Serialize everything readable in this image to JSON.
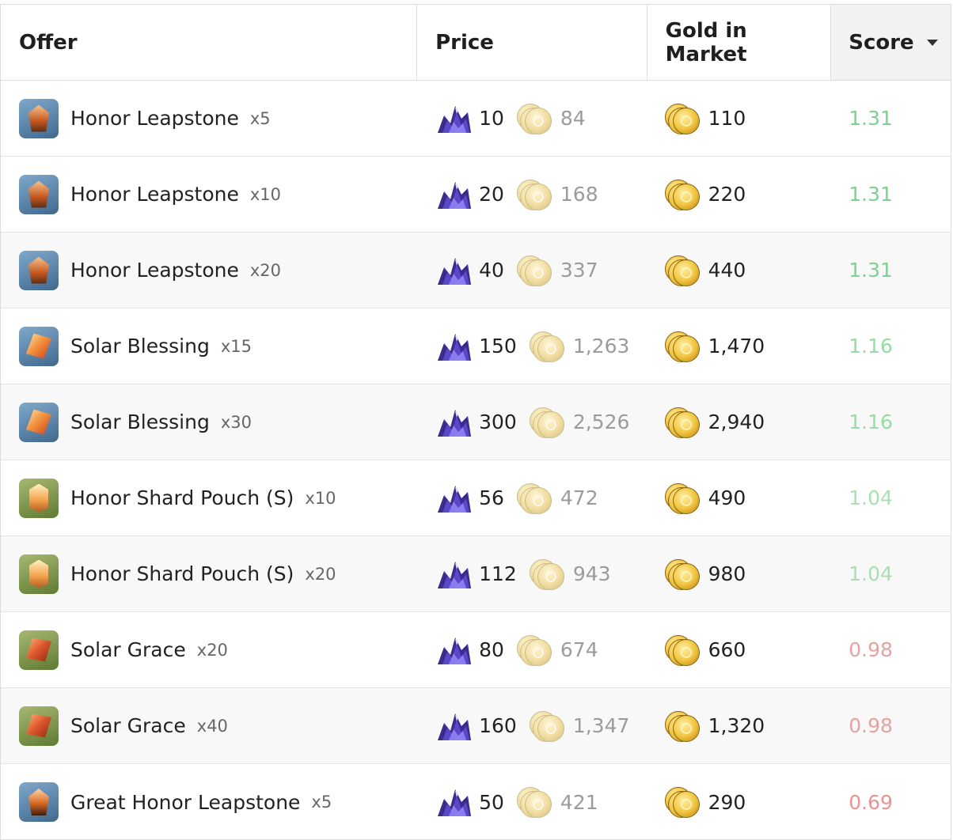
{
  "header": {
    "offer": "Offer",
    "price": "Price",
    "gold_in_market": "Gold in Market",
    "score": "Score"
  },
  "colors": {
    "score_good": "#5fcf7d",
    "score_ok": "#8fd9a1",
    "score_bad": "#e58b8b"
  },
  "rows": [
    {
      "name": "Honor Leapstone",
      "qty": "x5",
      "icon": "honor-leapstone-icon",
      "crystals": "10",
      "gold_equiv": "84",
      "market_gold": "110",
      "score": "1.31",
      "score_color": "#7ed08f"
    },
    {
      "name": "Honor Leapstone",
      "qty": "x10",
      "icon": "honor-leapstone-icon",
      "crystals": "20",
      "gold_equiv": "168",
      "market_gold": "220",
      "score": "1.31",
      "score_color": "#7ed08f"
    },
    {
      "name": "Honor Leapstone",
      "qty": "x20",
      "icon": "honor-leapstone-icon",
      "crystals": "40",
      "gold_equiv": "337",
      "market_gold": "440",
      "score": "1.31",
      "score_color": "#7ed08f"
    },
    {
      "name": "Solar Blessing",
      "qty": "x15",
      "icon": "solar-blessing-icon",
      "crystals": "150",
      "gold_equiv": "1,263",
      "market_gold": "1,470",
      "score": "1.16",
      "score_color": "#97dba6"
    },
    {
      "name": "Solar Blessing",
      "qty": "x30",
      "icon": "solar-blessing-icon",
      "crystals": "300",
      "gold_equiv": "2,526",
      "market_gold": "2,940",
      "score": "1.16",
      "score_color": "#97dba6"
    },
    {
      "name": "Honor Shard Pouch (S)",
      "qty": "x10",
      "icon": "honor-shard-pouch-icon",
      "crystals": "56",
      "gold_equiv": "472",
      "market_gold": "490",
      "score": "1.04",
      "score_color": "#a9dfb4"
    },
    {
      "name": "Honor Shard Pouch (S)",
      "qty": "x20",
      "icon": "honor-shard-pouch-icon",
      "crystals": "112",
      "gold_equiv": "943",
      "market_gold": "980",
      "score": "1.04",
      "score_color": "#a9dfb4"
    },
    {
      "name": "Solar Grace",
      "qty": "x20",
      "icon": "solar-grace-icon",
      "crystals": "80",
      "gold_equiv": "674",
      "market_gold": "660",
      "score": "0.98",
      "score_color": "#e7a1a1"
    },
    {
      "name": "Solar Grace",
      "qty": "x40",
      "icon": "solar-grace-icon",
      "crystals": "160",
      "gold_equiv": "1,347",
      "market_gold": "1,320",
      "score": "0.98",
      "score_color": "#e7a1a1"
    },
    {
      "name": "Great Honor Leapstone",
      "qty": "x5",
      "icon": "great-honor-leapstone-icon",
      "crystals": "50",
      "gold_equiv": "421",
      "market_gold": "290",
      "score": "0.69",
      "score_color": "#e99393"
    }
  ]
}
